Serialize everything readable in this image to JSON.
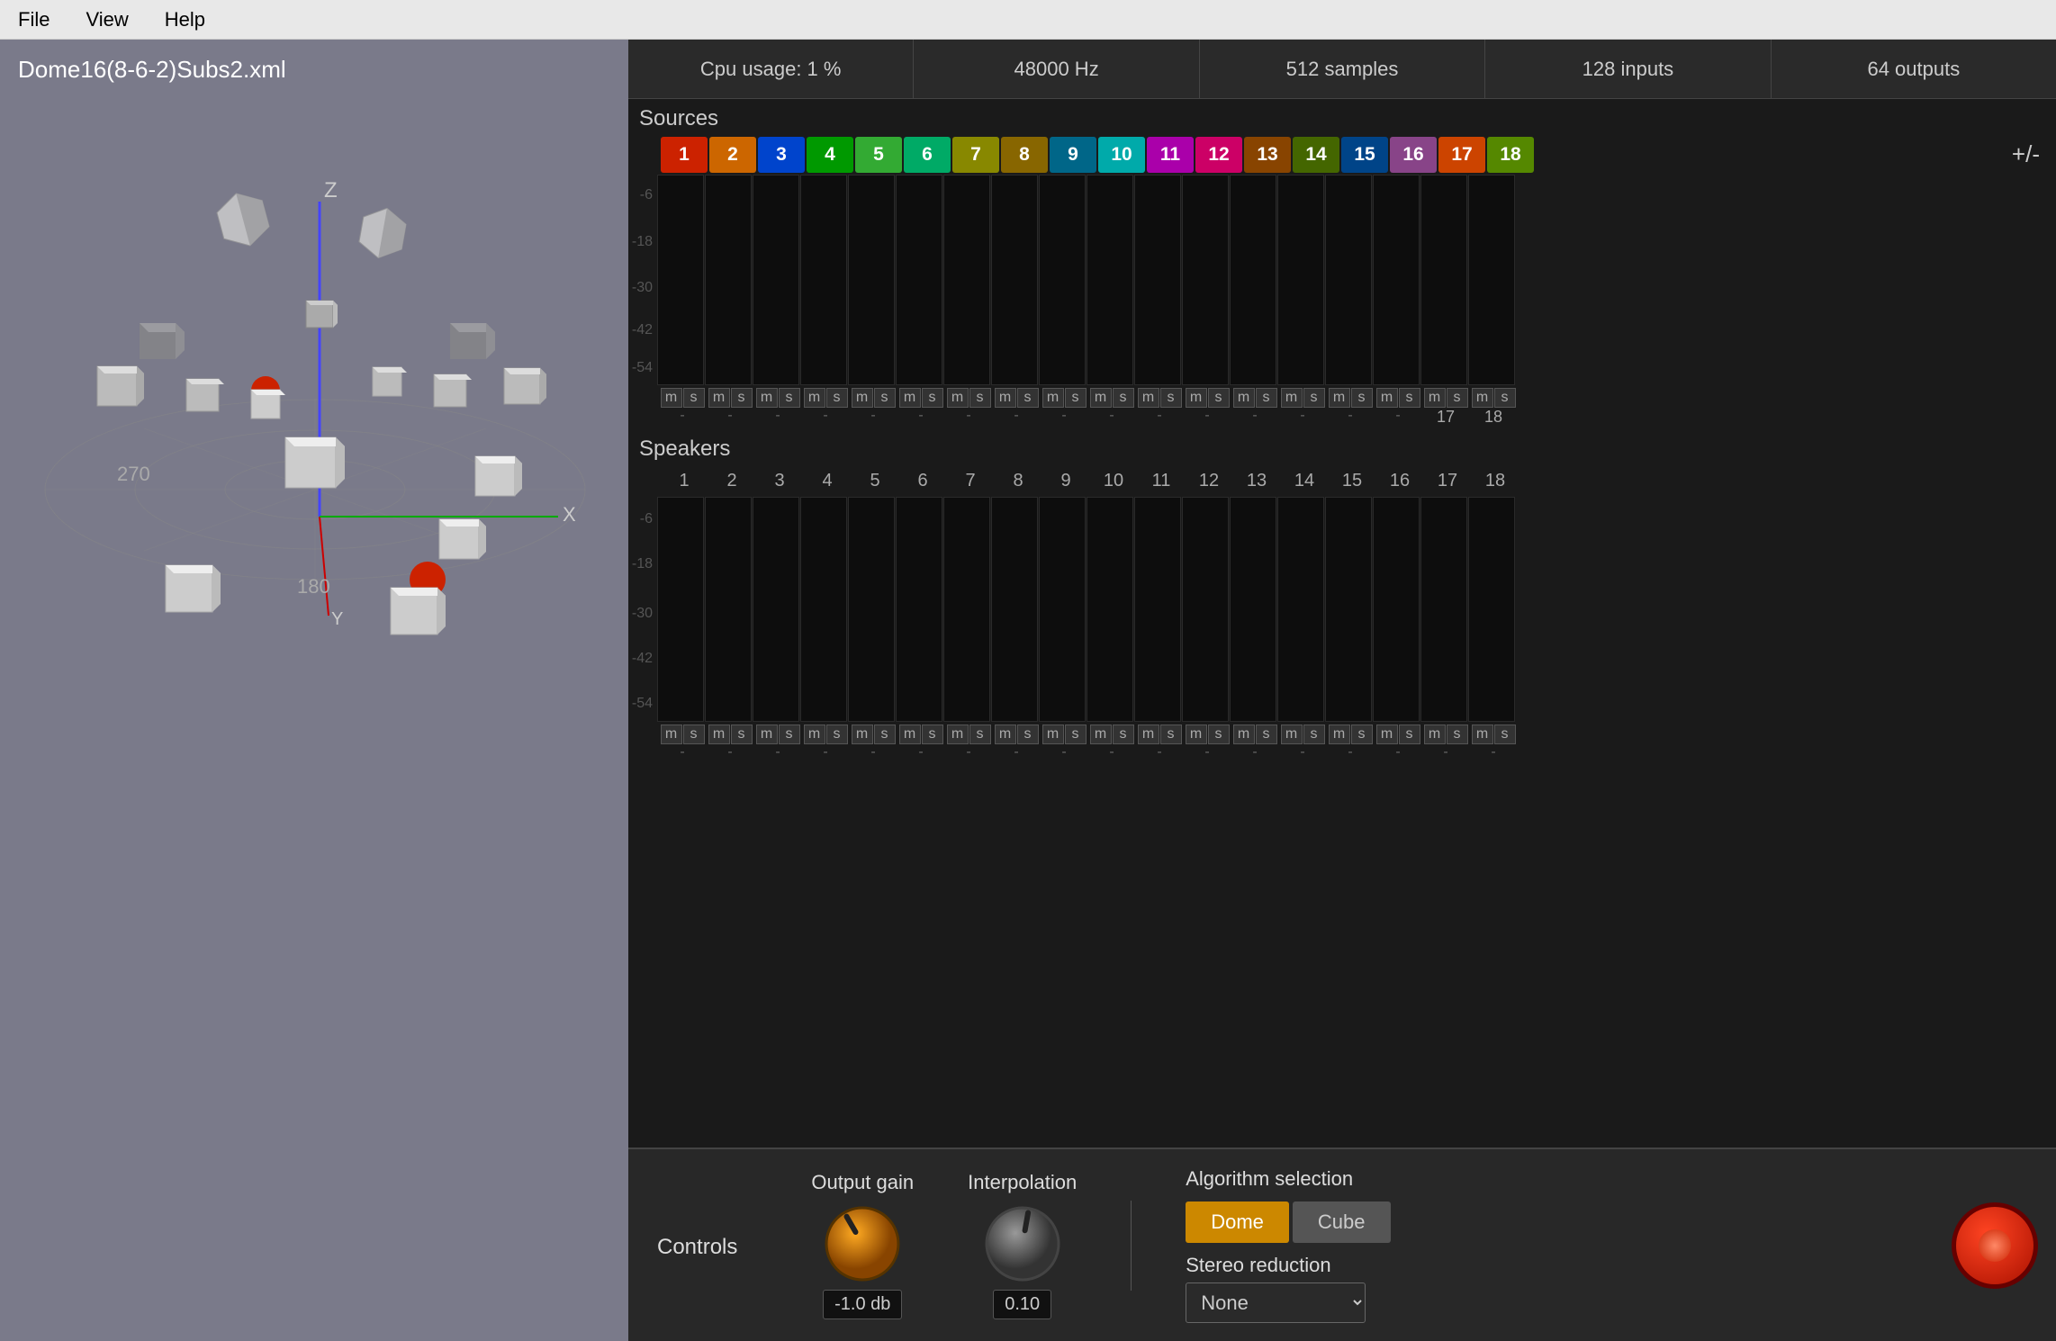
{
  "menubar": {
    "items": [
      "File",
      "View",
      "Help"
    ]
  },
  "status": {
    "cpu": "Cpu usage: 1 %",
    "hz": "48000 Hz",
    "samples": "512 samples",
    "inputs": "128 inputs",
    "outputs": "64 outputs"
  },
  "scene": {
    "title": "Dome16(8-6-2)Subs2.xml"
  },
  "sources": {
    "label": "Sources",
    "numbers": [
      1,
      2,
      3,
      4,
      5,
      6,
      7,
      8,
      9,
      10,
      11,
      12,
      13,
      14,
      15,
      16,
      17,
      18
    ],
    "colors": [
      "#cc2200",
      "#cc6600",
      "#0044cc",
      "#009900",
      "#33aa33",
      "#00aa66",
      "#888800",
      "#886600",
      "#006688",
      "#00aaaa",
      "#aa00aa",
      "#cc0066",
      "#884400",
      "#446600",
      "#004488",
      "#884488",
      "#cc4400",
      "#558800"
    ],
    "db_labels": [
      "-6",
      "-18",
      "-30",
      "-42",
      "-54"
    ],
    "ms_labels_17": "17",
    "ms_labels_18": "18"
  },
  "speakers": {
    "label": "Speakers",
    "numbers": [
      1,
      2,
      3,
      4,
      5,
      6,
      7,
      8,
      9,
      10,
      11,
      12,
      13,
      14,
      15,
      16,
      17,
      18
    ],
    "db_labels": [
      "-6",
      "-18",
      "-30",
      "-42",
      "-54"
    ]
  },
  "controls": {
    "label": "Controls",
    "output_gain": {
      "label": "Output gain",
      "value": "-1.0 db"
    },
    "interpolation": {
      "label": "Interpolation",
      "value": "0.10"
    },
    "algorithm": {
      "label": "Algorithm selection",
      "dome_label": "Dome",
      "cube_label": "Cube",
      "active": "Dome"
    },
    "stereo": {
      "label": "Stereo reduction",
      "options": [
        "None"
      ],
      "selected": "None"
    }
  },
  "plus_minus": "+/-"
}
